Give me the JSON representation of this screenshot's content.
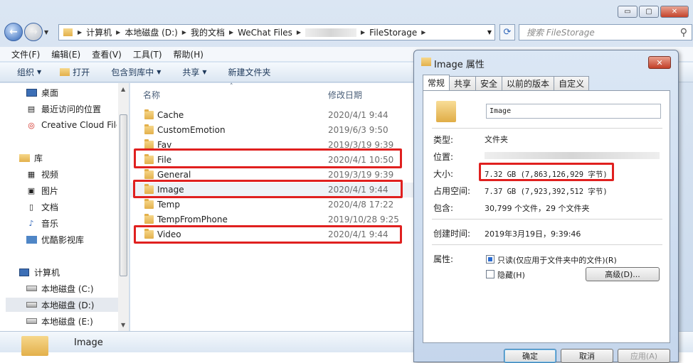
{
  "explorer": {
    "caption_buttons": {
      "minimize": "▭",
      "maximize": "▢",
      "close": "✕"
    },
    "address_crumbs": [
      "计算机",
      "本地磁盘 (D:)",
      "我的文档",
      "WeChat Files",
      "FileStorage"
    ],
    "search_placeholder": "搜索 FileStorage",
    "menu": [
      "文件(F)",
      "编辑(E)",
      "查看(V)",
      "工具(T)",
      "帮助(H)"
    ],
    "toolbar": {
      "organize": "组织",
      "open": "打开",
      "include": "包含到库中",
      "share": "共享",
      "new_folder": "新建文件夹"
    },
    "nav_items": {
      "desktop": "桌面",
      "recent": "最近访问的位置",
      "creative_cloud": "Creative Cloud Files",
      "libraries": "库",
      "videos": "视频",
      "pictures": "图片",
      "documents": "文档",
      "music": "音乐",
      "youku": "优酷影视库",
      "computer": "计算机",
      "drive_c": "本地磁盘 (C:)",
      "drive_d": "本地磁盘 (D:)",
      "drive_e": "本地磁盘 (E:)"
    },
    "columns": {
      "name": "名称",
      "modified": "修改日期"
    },
    "files": [
      {
        "name": "Cache",
        "date": "2020/4/1 9:44"
      },
      {
        "name": "CustomEmotion",
        "date": "2019/6/3 9:50"
      },
      {
        "name": "Fav",
        "date": "2019/3/19 9:39"
      },
      {
        "name": "File",
        "date": "2020/4/1 10:50"
      },
      {
        "name": "General",
        "date": "2019/3/19 9:39"
      },
      {
        "name": "Image",
        "date": "2020/4/1 9:44"
      },
      {
        "name": "Temp",
        "date": "2020/4/8 17:22"
      },
      {
        "name": "TempFromPhone",
        "date": "2019/10/28 9:25"
      },
      {
        "name": "Video",
        "date": "2020/4/1 9:44"
      }
    ],
    "details_name": "Image"
  },
  "props": {
    "title": "Image 属性",
    "close": "✕",
    "tabs": [
      "常规",
      "共享",
      "安全",
      "以前的版本",
      "自定义"
    ],
    "name_value": "Image",
    "type_label": "类型:",
    "type_value": "文件夹",
    "location_label": "位置:",
    "size_label": "大小:",
    "size_value": "7.32 GB (7,863,126,929 字节)",
    "disk_label": "占用空间:",
    "disk_value": "7.37 GB (7,923,392,512 字节)",
    "contains_label": "包含:",
    "contains_value": "30,799 个文件，29 个文件夹",
    "created_label": "创建时间:",
    "created_value": "2019年3月19日，9:39:46",
    "attrs_label": "属性:",
    "readonly_label": "只读(仅应用于文件夹中的文件)(R)",
    "hidden_label": "隐藏(H)",
    "advanced_button": "高级(D)...",
    "ok": "确定",
    "cancel": "取消",
    "apply": "应用(A)"
  },
  "colors": {
    "highlight_box": "#e0201f",
    "titlebar": "#c9d9ec"
  }
}
